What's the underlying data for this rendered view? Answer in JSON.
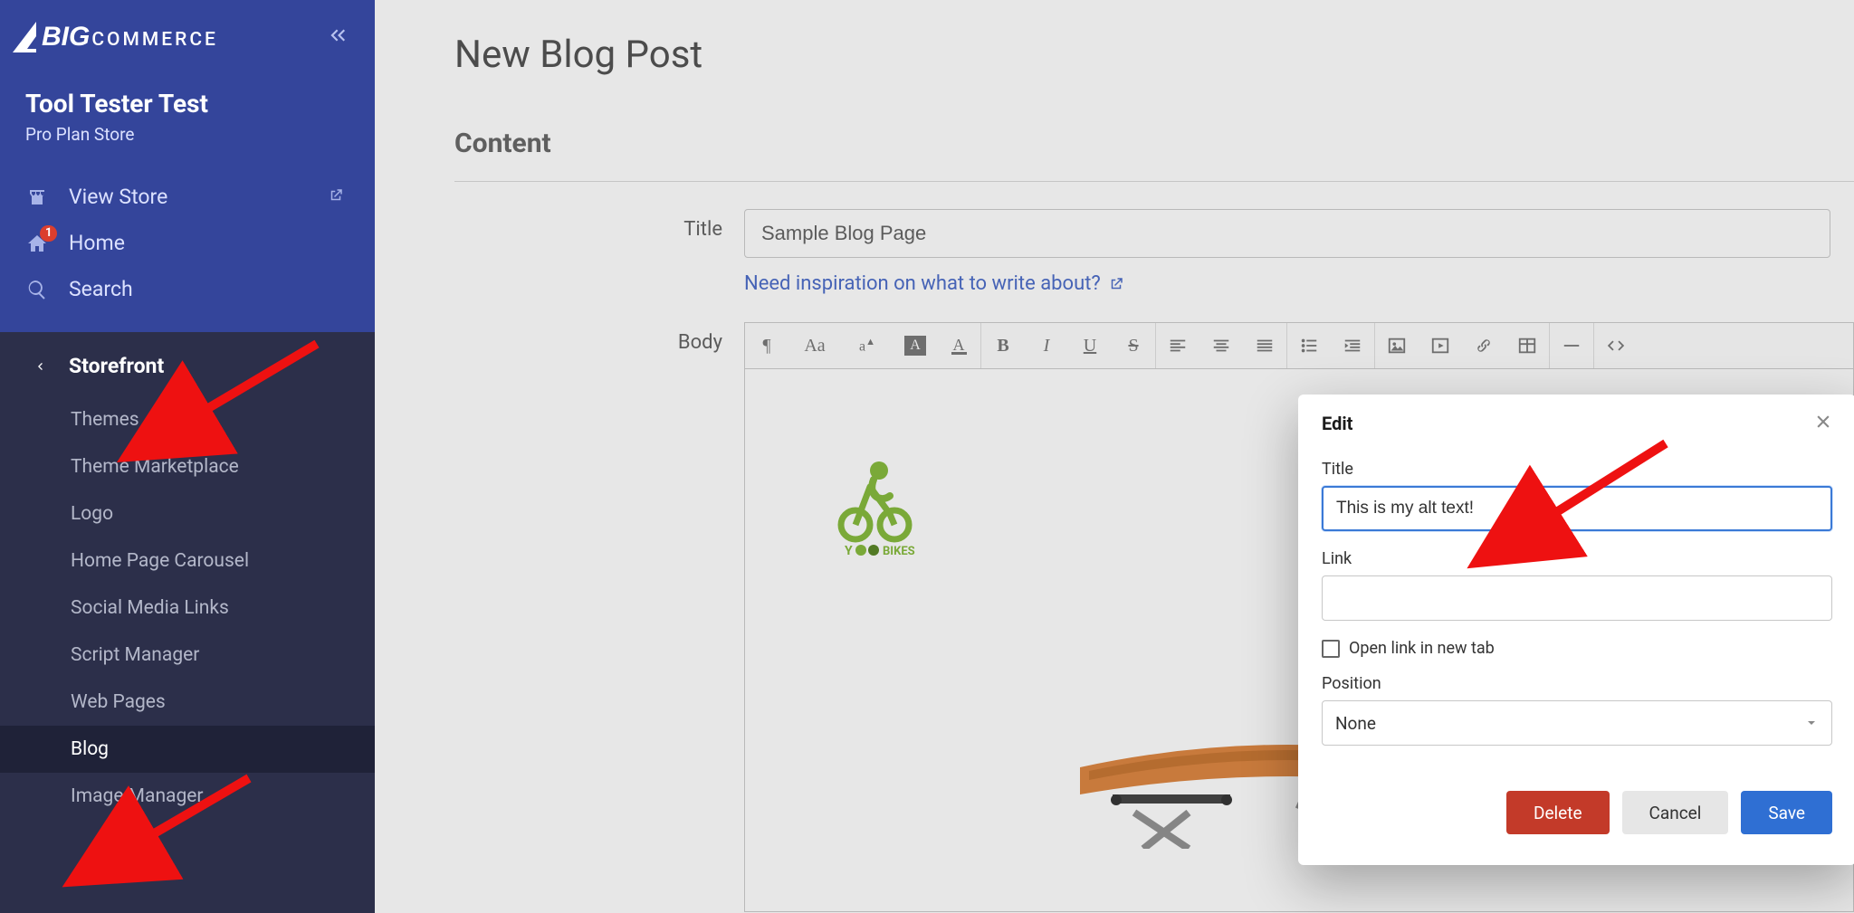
{
  "brand": {
    "big": "BIG",
    "rest": "COMMERCE"
  },
  "store": {
    "name": "Tool Tester Test",
    "plan": "Pro Plan Store"
  },
  "quickLinks": {
    "viewStore": "View Store",
    "home": "Home",
    "homeBadge": "1",
    "search": "Search"
  },
  "section": {
    "title": "Storefront",
    "items": [
      "Themes",
      "Theme Marketplace",
      "Logo",
      "Home Page Carousel",
      "Social Media Links",
      "Script Manager",
      "Web Pages",
      "Blog",
      "Image Manager"
    ],
    "activeIndex": 7
  },
  "page": {
    "title": "New Blog Post",
    "section": "Content",
    "titleLabel": "Title",
    "titleValue": "Sample Blog Page",
    "inspirationLink": "Need inspiration on what to write about?",
    "bodyLabel": "Body"
  },
  "toolbar": {
    "pilcrow": "¶",
    "Aa": "Aa",
    "aCaret": "aI",
    "bgA": "A",
    "colorA": "A",
    "bold": "B",
    "italic": "I",
    "underline": "U",
    "strike": "S"
  },
  "modal": {
    "header": "Edit",
    "titleLabel": "Title",
    "titleValue": "This is my alt text!",
    "linkLabel": "Link",
    "linkValue": "",
    "newTabLabel": "Open link in new tab",
    "positionLabel": "Position",
    "positionValue": "None",
    "delete": "Delete",
    "cancel": "Cancel",
    "save": "Save"
  }
}
